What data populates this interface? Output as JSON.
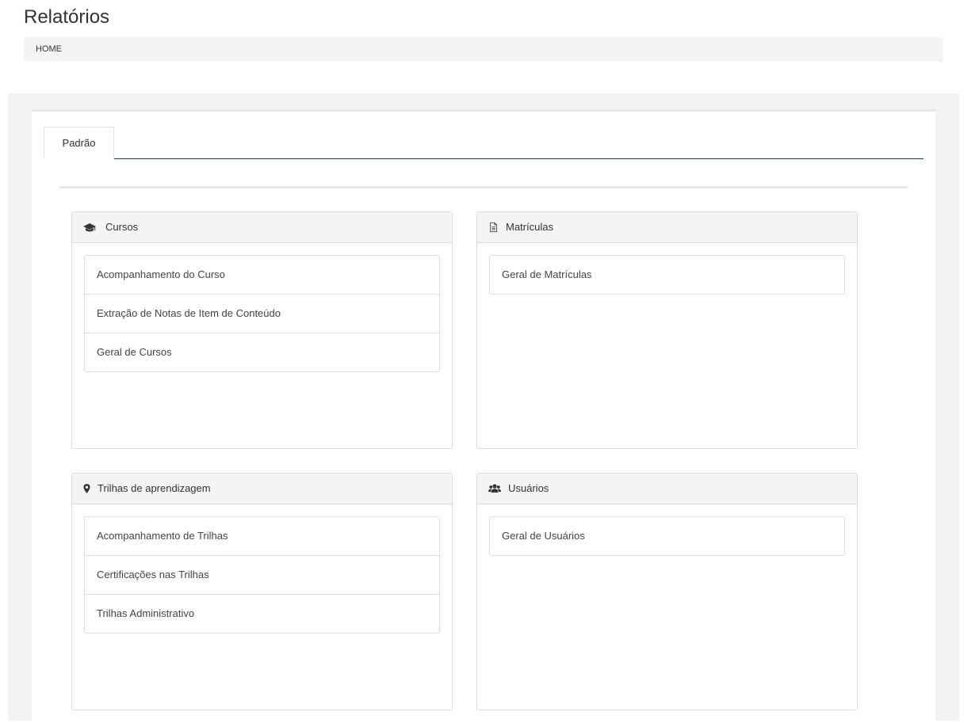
{
  "page": {
    "title": "Relatórios"
  },
  "breadcrumb": {
    "home": "HOME"
  },
  "tabs": [
    {
      "label": "Padrão"
    }
  ],
  "panels": {
    "cursos": {
      "title": "Cursos",
      "icon": "graduation-cap-icon",
      "items": [
        "Acompanhamento do Curso",
        "Extração de Notas de Item de Conteúdo",
        "Geral de Cursos"
      ]
    },
    "matriculas": {
      "title": "Matrículas",
      "icon": "document-icon",
      "items": [
        "Geral de Matrículas"
      ]
    },
    "trilhas": {
      "title": "Trilhas de aprendizagem",
      "icon": "map-marker-icon",
      "items": [
        "Acompanhamento de Trilhas",
        "Certificações nas Trilhas",
        "Trilhas Administrativo"
      ]
    },
    "usuarios": {
      "title": "Usuários",
      "icon": "users-icon",
      "items": [
        "Geral de Usuários"
      ]
    }
  },
  "colors": {
    "tab_underline": "#1e3a4c",
    "panel_header_bg": "#f4f4f4",
    "outer_bg": "#f2f2f2"
  }
}
